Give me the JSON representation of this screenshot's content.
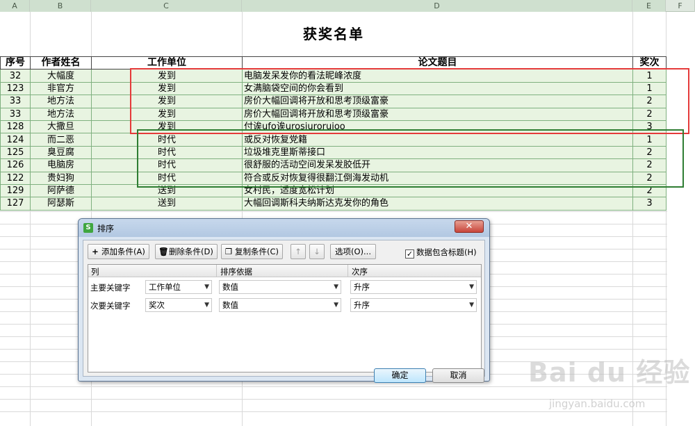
{
  "columns": [
    "A",
    "B",
    "C",
    "D",
    "E",
    "F"
  ],
  "sheet_title": "获奖名单",
  "table": {
    "headers": [
      "序号",
      "作者姓名",
      "工作单位",
      "论文题目",
      "奖次"
    ],
    "rows": [
      [
        "32",
        "大幅度",
        "发到",
        "电脑发呆发你的看法昵峰浓度",
        "1"
      ],
      [
        "123",
        "非官方",
        "发到",
        "女满脑袋空间的你会看到",
        "1"
      ],
      [
        "33",
        "地方法",
        "发到",
        "房价大幅回调将开放和思考顶级富豪",
        "2"
      ],
      [
        "33",
        "地方法",
        "发到",
        "房价大幅回调将开放和思考顶级富豪",
        "2"
      ],
      [
        "128",
        "大撒旦",
        "发到",
        "付诶ufo诶urosiuroruioo",
        "3"
      ],
      [
        "124",
        "而二恶",
        "时代",
        "或反对恢复党籍",
        "1"
      ],
      [
        "125",
        "臭豆腐",
        "时代",
        "垃圾堆克里斯蒂接口",
        "2"
      ],
      [
        "126",
        "电脑房",
        "时代",
        "很舒服的活动空间发呆发胶低开",
        "2"
      ],
      [
        "122",
        "贵妇狗",
        "时代",
        "符合或反对恢复得很翻江倒海发动机",
        "2"
      ],
      [
        "129",
        "阿萨德",
        "送到",
        "女村民，适度宽松计划",
        "2"
      ],
      [
        "127",
        "阿瑟斯",
        "送到",
        "大幅回调斯科夫纳斯达克发你的角色",
        "3"
      ]
    ]
  },
  "dialog": {
    "icon_letter": "S",
    "title": "排序",
    "close_glyph": "✕",
    "toolbar": {
      "add": "添加条件(A)",
      "delete": "删除条件(D)",
      "copy": "复制条件(C)",
      "up_glyph": "↑",
      "down_glyph": "↓",
      "options": "选项(O)...",
      "header_checkbox": "数据包含标题(H)",
      "header_checked": true
    },
    "grid_headers": {
      "col": "列",
      "basis": "排序依据",
      "order": "次序"
    },
    "rows": [
      {
        "label": "主要关键字",
        "column": "工作单位",
        "basis": "数值",
        "order": "升序"
      },
      {
        "label": "次要关键字",
        "column": "奖次",
        "basis": "数值",
        "order": "升序"
      }
    ],
    "ok": "确定",
    "cancel": "取消"
  },
  "watermark": {
    "main": "Bai du 经验",
    "sub": "jingyan.baidu.com"
  }
}
